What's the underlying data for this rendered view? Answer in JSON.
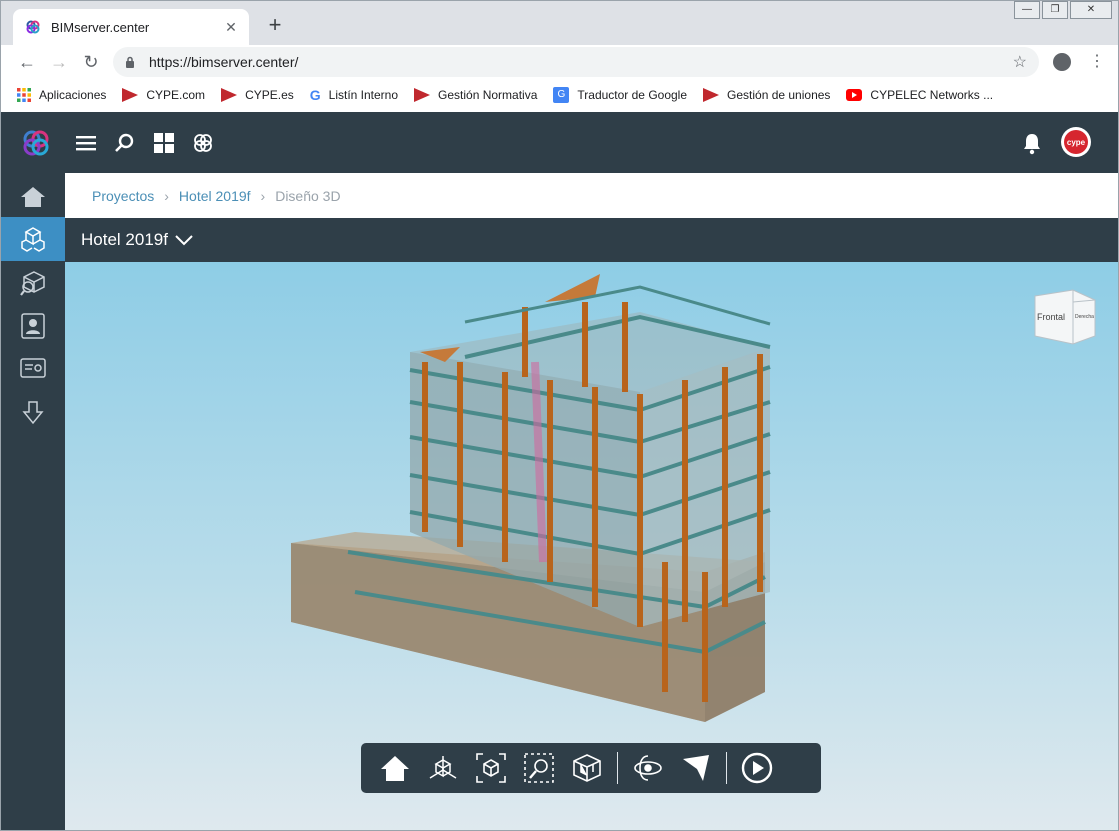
{
  "browser": {
    "tab_title": "BIMserver.center",
    "tab_close": "✕",
    "new_tab": "+",
    "url": "https://bimserver.center/",
    "bookmarks": [
      {
        "label": "Aplicaciones",
        "icon": "apps-grid-icon"
      },
      {
        "label": "CYPE.com",
        "icon": "cype-icon"
      },
      {
        "label": "CYPE.es",
        "icon": "cype-icon"
      },
      {
        "label": "Listín Interno",
        "icon": "google-icon"
      },
      {
        "label": "Gestión Normativa",
        "icon": "cype-icon"
      },
      {
        "label": "Traductor de Google",
        "icon": "google-translate-icon"
      },
      {
        "label": "Gestión de uniones",
        "icon": "cype-icon"
      },
      {
        "label": "CYPELEC Networks ...",
        "icon": "youtube-icon"
      }
    ]
  },
  "app": {
    "avatar_text": "cype",
    "header_icons": [
      "menu-icon",
      "search-icon",
      "grid-icon",
      "bimserver-icon"
    ],
    "rail_items": [
      {
        "name": "home",
        "icon": "home-icon"
      },
      {
        "name": "3d-model",
        "icon": "cubes-icon",
        "active": true
      },
      {
        "name": "search-model",
        "icon": "search-cube-icon"
      },
      {
        "name": "contacts",
        "icon": "contact-card-icon"
      },
      {
        "name": "certificate",
        "icon": "certificate-icon"
      },
      {
        "name": "download",
        "icon": "download-icon"
      }
    ],
    "breadcrumb": [
      "Proyectos",
      "Hotel 2019f",
      "Diseño 3D"
    ],
    "project_name": "Hotel 2019f",
    "viewcube": {
      "front": "Frontal",
      "right": "Derecha"
    },
    "viewer_tools": [
      "home-view-icon",
      "axes-icon",
      "fit-view-icon",
      "zoom-window-icon",
      "section-box-icon",
      "orbit-icon",
      "select-pointer-icon",
      "play-icon"
    ],
    "colors": {
      "header": "#2f3e48",
      "active": "#3d8fc4",
      "link": "#4b8fb6"
    }
  }
}
